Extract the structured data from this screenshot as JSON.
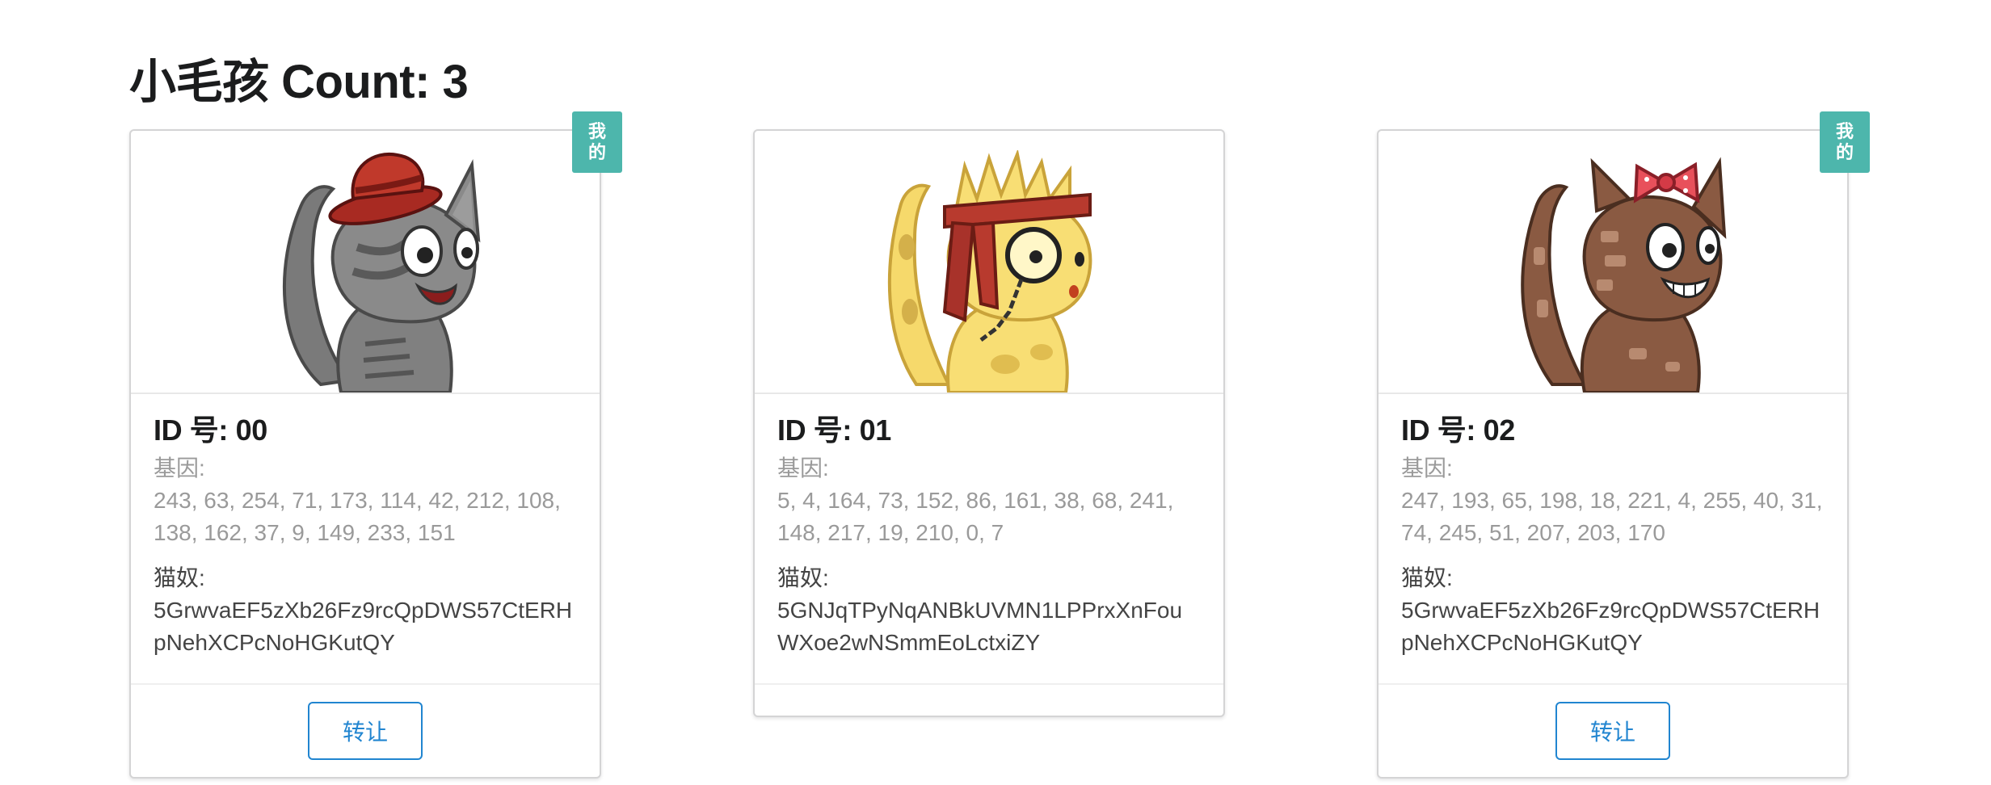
{
  "page": {
    "title": "小毛孩 Count: 3"
  },
  "colors": {
    "badge": "#4db6ac",
    "button": "#2185d0",
    "muted_text": "#9a9a9a"
  },
  "kitties": [
    {
      "mine": true,
      "badge_line1": "我",
      "badge_line2": "的",
      "id_text": "ID 号: 00",
      "dna_label": "基因:",
      "dna_value": "243, 63, 254, 71, 173, 114, 42, 212, 108, 138, 162, 37, 9, 149, 233, 151",
      "owner_label": "猫奴:",
      "owner_value": "5GrwvaEF5zXb26Fz9rcQpDWS57CtERHpNehXCPcNoHGKutQY",
      "button_label": "转让",
      "image": "gray-cat-red-hat"
    },
    {
      "mine": false,
      "id_text": "ID 号: 01",
      "dna_label": "基因:",
      "dna_value": "5, 4, 164, 73, 152, 86, 161, 38, 68, 241, 148, 217, 19, 210, 0, 7",
      "owner_label": "猫奴:",
      "owner_value": "5GNJqTPyNqANBkUVMN1LPPrxXnFouWXoe2wNSmmEoLctxiZY",
      "image": "yellow-cat-monocle"
    },
    {
      "mine": true,
      "badge_line1": "我",
      "badge_line2": "的",
      "id_text": "ID 号: 02",
      "dna_label": "基因:",
      "dna_value": "247, 193, 65, 198, 18, 221, 4, 255, 40, 31, 74, 245, 51, 207, 203, 170",
      "owner_label": "猫奴:",
      "owner_value": "5GrwvaEF5zXb26Fz9rcQpDWS57CtERHpNehXCPcNoHGKutQY",
      "button_label": "转让",
      "image": "brown-cat-bow"
    }
  ]
}
